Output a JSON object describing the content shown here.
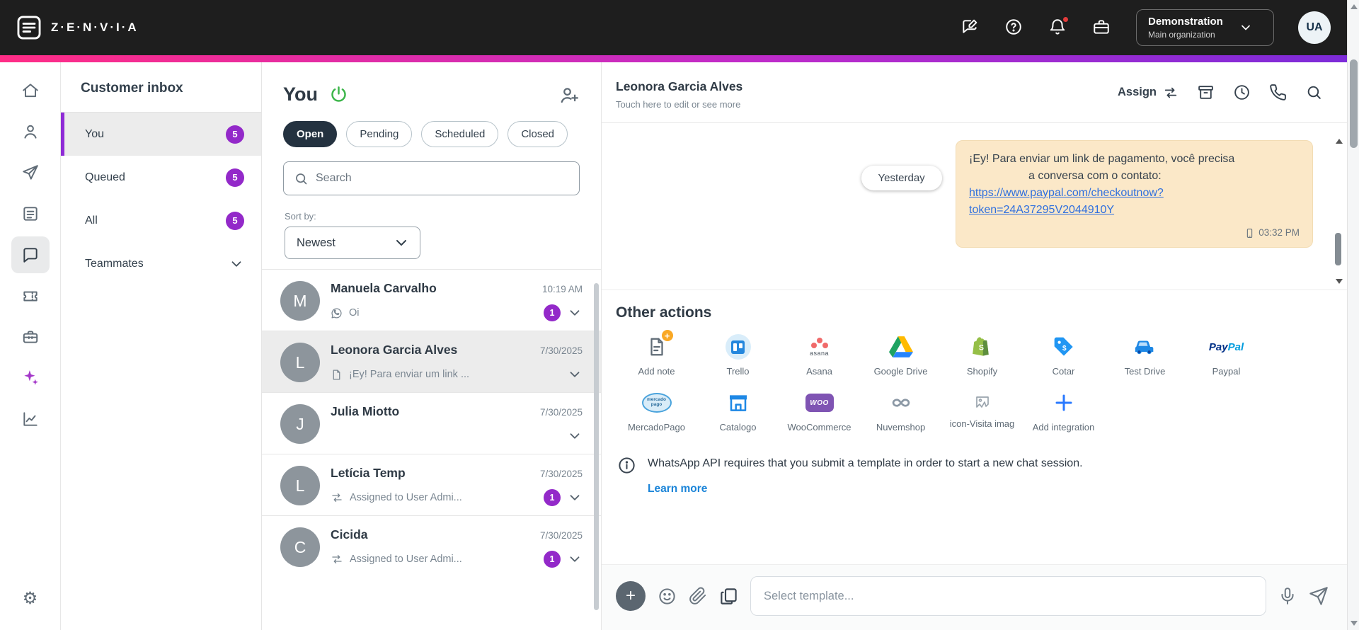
{
  "colors": {
    "topbar_bg": "#1e1e1e",
    "gradient_start": "#ff2d86",
    "gradient_end": "#7b2bd9",
    "accent_purple": "#9329c9",
    "active_pill": "#243240",
    "bubble_bg": "#fbe8c8",
    "link_blue": "#2f6fde",
    "learn_more_blue": "#1a84d8",
    "power_green": "#3cb54a"
  },
  "topbar": {
    "brand": "Z·E·N·V·I·A",
    "org_name": "Demonstration",
    "org_sub": "Main organization",
    "avatar": "UA"
  },
  "inbox": {
    "title": "Customer inbox",
    "items": [
      {
        "label": "You",
        "badge": "5"
      },
      {
        "label": "Queued",
        "badge": "5"
      },
      {
        "label": "All",
        "badge": "5"
      },
      {
        "label": "Teammates"
      }
    ]
  },
  "list": {
    "title": "You",
    "filters": [
      {
        "label": "Open"
      },
      {
        "label": "Pending"
      },
      {
        "label": "Scheduled"
      },
      {
        "label": "Closed"
      }
    ],
    "search_placeholder": "Search",
    "sort_label": "Sort by:",
    "sort_value": "Newest",
    "conversations": [
      {
        "initial": "M",
        "name": "Manuela Carvalho",
        "time": "10:19 AM",
        "preview": "Oi",
        "badge": "1"
      },
      {
        "initial": "L",
        "name": "Leonora Garcia Alves",
        "time": "7/30/2025",
        "preview": "¡Ey! Para enviar um link ..."
      },
      {
        "initial": "J",
        "name": "Julia Miotto",
        "time": "7/30/2025",
        "preview": ""
      },
      {
        "initial": "L",
        "name": "Letícia Temp",
        "time": "7/30/2025",
        "preview": "Assigned to User Admi...",
        "badge": "1"
      },
      {
        "initial": "C",
        "name": "Cicida",
        "time": "7/30/2025",
        "preview": "Assigned to User Admi...",
        "badge": "1"
      }
    ]
  },
  "chat": {
    "header": {
      "name": "Leonora Garcia Alves",
      "subtitle": "Touch here to edit or see more",
      "assign": "Assign"
    },
    "day_divider": "Yesterday",
    "message": {
      "line1": "¡Ey! Para enviar um link de pagamento, você precisa",
      "line2": "a conversa com o contato:",
      "link_line1": "https://www.paypal.com/checkoutnow?",
      "link_line2": "token=24A37295V2044910Y",
      "time": "03:32 PM"
    },
    "other_actions": {
      "title": "Other actions",
      "items": [
        {
          "label": "Add note",
          "icon": "add-note-icon"
        },
        {
          "label": "Trello",
          "icon": "trello-icon"
        },
        {
          "label": "Asana",
          "icon": "asana-icon"
        },
        {
          "label": "Google Drive",
          "icon": "google-drive-icon"
        },
        {
          "label": "Shopify",
          "icon": "shopify-icon"
        },
        {
          "label": "Cotar",
          "icon": "price-tag-icon"
        },
        {
          "label": "Test Drive",
          "icon": "car-icon"
        },
        {
          "label": "Paypal",
          "icon": "paypal-icon"
        },
        {
          "label": "MercadoPago",
          "icon": "mercadopago-icon"
        },
        {
          "label": "Catalogo",
          "icon": "storefront-icon"
        },
        {
          "label": "WooCommerce",
          "icon": "woocommerce-icon"
        },
        {
          "label": "Nuvemshop",
          "icon": "nuvemshop-icon"
        },
        {
          "label": "icon-Visita imag",
          "icon": "broken-image-icon"
        },
        {
          "label": "Add integration",
          "icon": "plus-icon"
        }
      ]
    },
    "icon_texts": {
      "asana": "asana",
      "paypal_a": "Pay",
      "paypal_b": "Pal",
      "woo": "WOO",
      "mp": "mercado pago"
    },
    "banner": {
      "text": "WhatsApp API requires that you submit a template in order to start a new chat session.",
      "link": "Learn more"
    },
    "composer": {
      "placeholder": "Select template..."
    }
  }
}
